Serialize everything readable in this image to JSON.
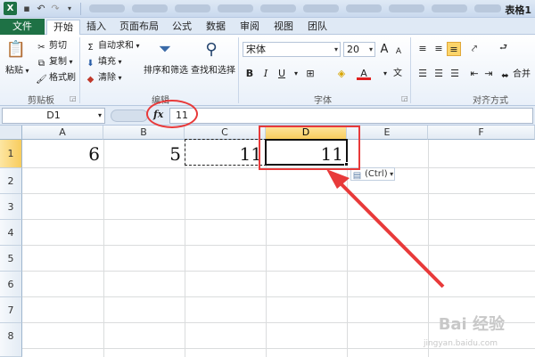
{
  "window": {
    "title": "表格1"
  },
  "ribbon_tabs": [
    "文件",
    "开始",
    "插入",
    "页面布局",
    "公式",
    "数据",
    "审阅",
    "视图",
    "团队"
  ],
  "active_tab": "开始",
  "clipboard": {
    "paste": "粘贴",
    "cut": "剪切",
    "copy": "复制",
    "format_painter": "格式刷",
    "group": "剪贴板"
  },
  "editing": {
    "autosum": "自动求和",
    "fill": "填充",
    "clear": "清除",
    "sort_filter": "排序和筛选",
    "find_select": "查找和选择",
    "group": "编辑"
  },
  "font": {
    "name": "宋体",
    "size": "20",
    "group": "字体",
    "bold": "B",
    "italic": "I",
    "underline": "U",
    "font_color": "A"
  },
  "alignment": {
    "merge": "合并",
    "group": "对齐方式"
  },
  "formula_bar": {
    "name_box": "D1",
    "fx": "fx",
    "value": "11"
  },
  "columns": [
    "A",
    "B",
    "C",
    "D",
    "E",
    "F"
  ],
  "selected_column": "D",
  "rows": [
    "1",
    "2",
    "3",
    "4",
    "5",
    "6",
    "7",
    "8"
  ],
  "selected_row": "1",
  "cells": {
    "A1": "6",
    "B1": "5",
    "C1": "11",
    "D1": "11"
  },
  "paste_options": {
    "label": "(Ctrl)"
  },
  "watermark": {
    "brand": "Bai 经验",
    "url": "jingyan.baidu.com"
  },
  "colors": {
    "excel_green": "#1e7145",
    "annotation_red": "#e83a3a",
    "selection_header": "#f8cc5d"
  }
}
